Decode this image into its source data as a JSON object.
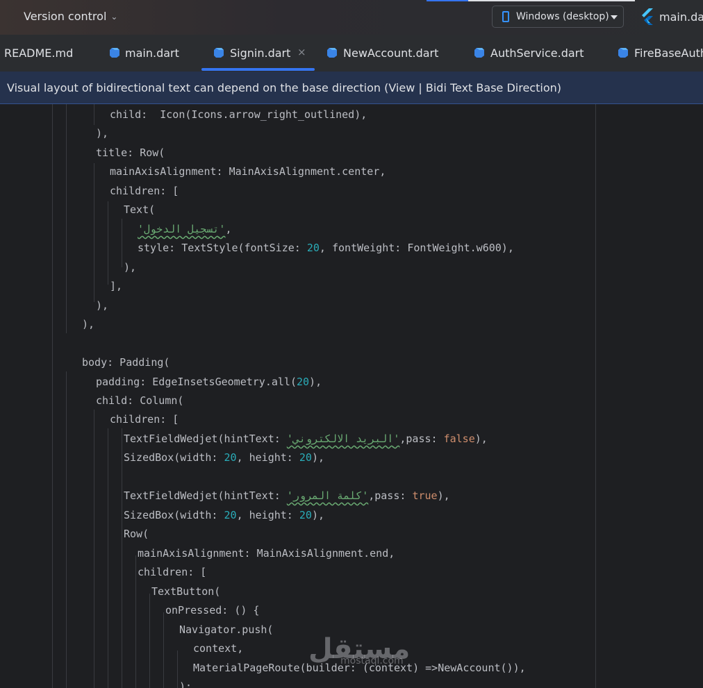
{
  "toolbar": {
    "version_control": "Version control",
    "device": "Windows (desktop)",
    "run_config": "main.dart"
  },
  "tabs": [
    {
      "label": "README.md"
    },
    {
      "label": "main.dart"
    },
    {
      "label": "Signin.dart",
      "active": true,
      "close": "×"
    },
    {
      "label": "NewAccount.dart"
    },
    {
      "label": "AuthService.dart"
    },
    {
      "label": "FireBaseAuth"
    }
  ],
  "banner": {
    "text": "Visual layout of bidirectional text can depend on the base direction (View | Bidi Text Base Direction)"
  },
  "colors": {
    "accent": "#3574f0",
    "string": "#6aab73",
    "number": "#2aacb8",
    "keyword": "#cf8e6d",
    "text": "#bcbec4",
    "background": "#1e1f22"
  },
  "code": {
    "l1": "child:  Icon(Icons.arrow_right_outlined),",
    "l2": "),",
    "l3": "title: Row(",
    "l4": "mainAxisAlignment: MainAxisAlignment.center,",
    "l5": "children: [",
    "l6": "Text(",
    "l7_str": "'تسجيل الدخول'",
    "l7_end": ",",
    "l8a": "style: TextStyle(fontSize: ",
    "l8n": "20",
    "l8b": ", fontWeight: FontWeight.w600),",
    "l9": "),",
    "l10": "],",
    "l11": "),",
    "l12": "),",
    "l14": "body: Padding(",
    "l15a": "padding: EdgeInsetsGeometry.all(",
    "l15n": "20",
    "l15b": "),",
    "l16": "child: Column(",
    "l17": "children: [",
    "l18a": "TextFieldWedjet(hintText: ",
    "l18s": "'البريد الالكتروني'",
    "l18b": ",pass: ",
    "l18k": "false",
    "l18c": "),",
    "l19a": "SizedBox(width: ",
    "l19n1": "20",
    "l19b": ", height: ",
    "l19n2": "20",
    "l19c": "),",
    "l21a": "TextFieldWedjet(hintText: ",
    "l21s": "'كلمة المرور'",
    "l21b": ",pass: ",
    "l21k": "true",
    "l21c": "),",
    "l22a": "SizedBox(width: ",
    "l22n1": "20",
    "l22b": ", height: ",
    "l22n2": "20",
    "l22c": "),",
    "l23": "Row(",
    "l24": "mainAxisAlignment: MainAxisAlignment.end,",
    "l25": "children: [",
    "l26": "TextButton(",
    "l27": "onPressed: () {",
    "l28": "Navigator.push(",
    "l29": "context,",
    "l30": "MaterialPageRoute(builder: (context) =>NewAccount()),",
    "l31": ");"
  },
  "watermark": {
    "text": "مستقل",
    "sub": "mostaql.com"
  }
}
